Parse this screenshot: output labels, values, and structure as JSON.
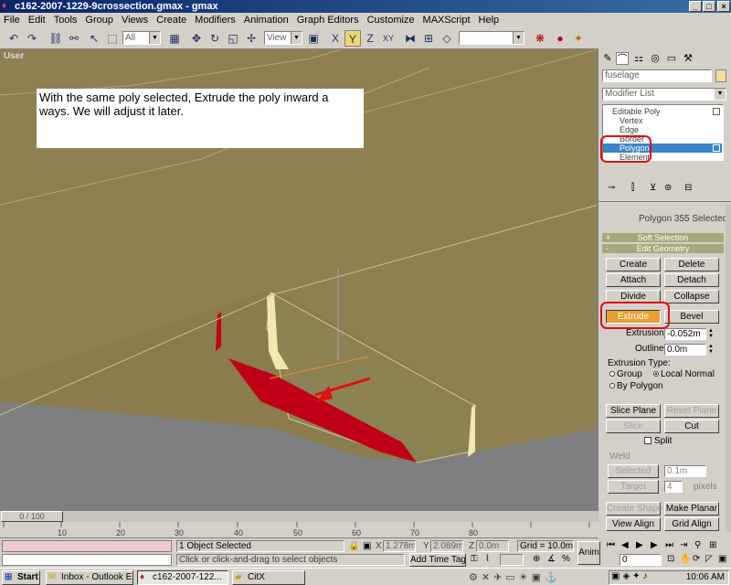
{
  "window": {
    "title": "c162-2007-1229-9crossection.gmax - gmax",
    "minimize": "_",
    "maximize": "□",
    "close": "×"
  },
  "menu": [
    "File",
    "Edit",
    "Tools",
    "Group",
    "Views",
    "Create",
    "Modifiers",
    "Animation",
    "Graph Editors",
    "Customize",
    "MAXScript",
    "Help"
  ],
  "toolbar": {
    "selection_filter": "All",
    "reference_coord": "View",
    "named_selection": ""
  },
  "viewport": {
    "label": "User",
    "note": "With the same poly selected, Extrude the poly inward a ways.  We will adjust it later."
  },
  "panel": {
    "object_name": "fuselage",
    "modifier_list": "Modifier List",
    "stack": [
      "Editable Poly",
      "Vertex",
      "Edge",
      "Border",
      "Polygon",
      "Element"
    ],
    "selection_info": "Polygon 355 Selected",
    "soft_selection": "Soft Selection",
    "edit_geometry": "Edit Geometry",
    "buttons": {
      "create": "Create",
      "delete": "Delete",
      "attach": "Attach",
      "detach": "Detach",
      "divide": "Divide",
      "collapse": "Collapse",
      "extrude": "Extrude",
      "bevel": "Bevel",
      "slice_plane": "Slice Plane",
      "reset_plane": "Reset Plane",
      "slice": "Slice",
      "cut": "Cut",
      "create_shape": "Create Shape",
      "make_planar": "Make Planar",
      "view_align": "View Align",
      "grid_align": "Grid Align",
      "weld_selected": "Selected",
      "weld_target": "Target"
    },
    "extrusion_label": "Extrusion",
    "extrusion_value": "-0.052m",
    "outline_label": "Outline",
    "outline_value": "0.0m",
    "extrusion_type_label": "Extrusion Type:",
    "radio_group": "Group",
    "radio_local_normal": "Local Normal",
    "radio_by_polygon": "By Polygon",
    "split_label": "Split",
    "weld_label": "Weld",
    "weld_selected_value": "0.1m",
    "weld_target_value": "4",
    "pixels_label": "pixels"
  },
  "timeline": {
    "slider": "0 / 100",
    "ticks": [
      "10",
      "20",
      "30",
      "40",
      "50",
      "60",
      "70",
      "80"
    ]
  },
  "status": {
    "selected": "1 Object Selected",
    "prompt": "Click or click-and-drag to select objects",
    "x_label": "X",
    "x_value": "1.278m",
    "y_label": "Y",
    "y_value": "2.089m",
    "z_label": "Z",
    "z_value": "0.0m",
    "grid": "Grid = 10.0m",
    "add_time_tag": "Add Time Tag",
    "anim": "Anim",
    "frame": "0"
  },
  "taskbar": {
    "start": "Start",
    "tasks": [
      "Inbox - Outlook E...",
      "c162-2007-122...",
      "CitX"
    ],
    "clock": "10:06 AM"
  },
  "colors": {
    "viewport_bg": "#7f7f7f",
    "model_fill": "#8e8050",
    "selected_poly": "#c00018",
    "stack_highlight": "#3a86c8",
    "extrude_button": "#e8a030",
    "annotation_red": "#e01010"
  }
}
